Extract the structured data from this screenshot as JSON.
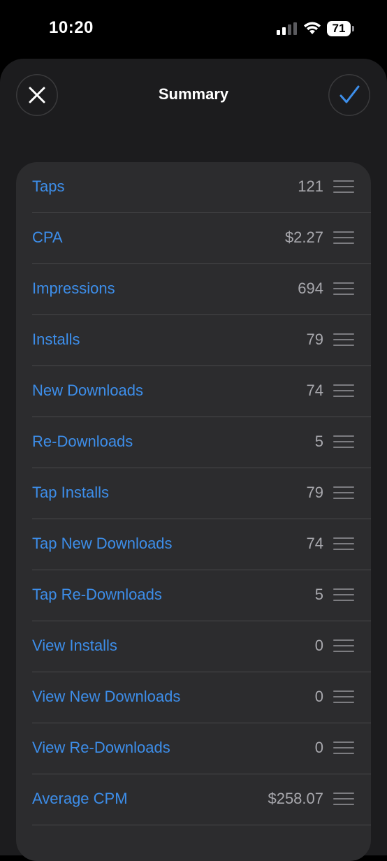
{
  "status_bar": {
    "time": "10:20",
    "battery": "71",
    "icons": [
      "signal-icon",
      "wifi-icon",
      "battery-icon"
    ]
  },
  "header": {
    "title": "Summary",
    "close_icon": "close-icon",
    "confirm_icon": "checkmark-icon"
  },
  "colors": {
    "accent": "#3d8eea",
    "sheet_background": "#1c1c1e",
    "card_background": "#2c2c2e",
    "value_text": "#a8a8ad"
  },
  "rows": [
    {
      "label": "Taps",
      "value": "121"
    },
    {
      "label": "CPA",
      "value": "$2.27"
    },
    {
      "label": "Impressions",
      "value": "694"
    },
    {
      "label": "Installs",
      "value": "79"
    },
    {
      "label": "New Downloads",
      "value": "74"
    },
    {
      "label": "Re-Downloads",
      "value": "5"
    },
    {
      "label": "Tap Installs",
      "value": "79"
    },
    {
      "label": "Tap New Downloads",
      "value": "74"
    },
    {
      "label": "Tap Re-Downloads",
      "value": "5"
    },
    {
      "label": "View Installs",
      "value": "0"
    },
    {
      "label": "View New Downloads",
      "value": "0"
    },
    {
      "label": "View Re-Downloads",
      "value": "0"
    },
    {
      "label": "Average CPM",
      "value": "$258.07"
    },
    {
      "label": "",
      "value": ""
    }
  ]
}
